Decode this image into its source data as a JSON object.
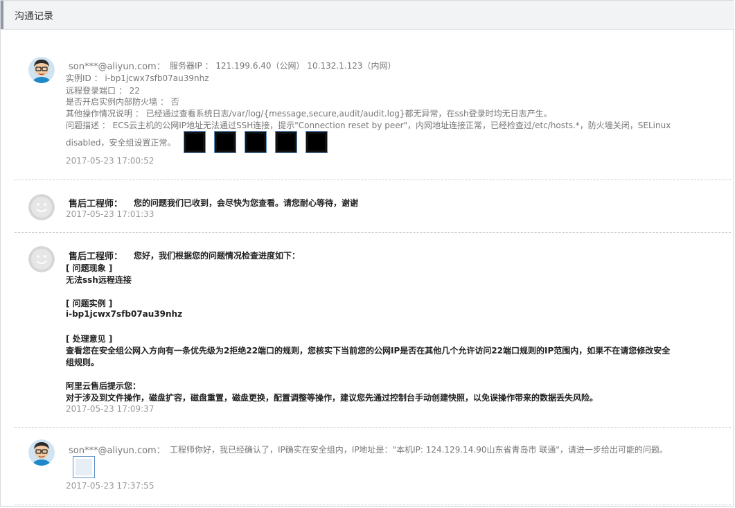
{
  "header": {
    "title": "沟通记录"
  },
  "messages": [
    {
      "sender": "son***@aliyun.com：",
      "lines": [
        "服务器IP ： 121.199.6.40（公网） 10.132.1.123（内网）",
        "实例ID ： i-bp1jcwx7sfb07au39nhz",
        "远程登录端口 ： 22",
        "是否开启实例内部防火墙 ： 否",
        "其他操作情况说明 ： 已经通过查看系统日志/var/log/{message,secure,audit/audit.log}都无异常，在ssh登录时均无日志产生。",
        "问题描述 ： ECS云主机的公网IP地址无法通过SSH连接，提示\"Connection reset by peer\"，内网地址连接正常，已经检查过/etc/hosts.*，防火墙关闭，SELinux",
        "disabled，安全组设置正常。"
      ],
      "time": "2017-05-23 17:00:52"
    },
    {
      "sender": "售后工程师：",
      "lines": [
        "您的问题我们已收到，会尽快为您查看。请您耐心等待，谢谢"
      ],
      "time": "2017-05-23 17:01:33"
    },
    {
      "sender": "售后工程师：",
      "lines": [
        "您好，我们根据您的问题情况检查进度如下：",
        "[ 问题现象 ]",
        "无法ssh远程连接",
        "[ 问题实例 ]",
        "i-bp1jcwx7sfb07au39nhz",
        "[ 处理意见 ]",
        "查看您在安全组公网入方向有一条优先级为2拒绝22端口的规则，您核实下当前您的公网IP是否在其他几个允许访问22端口规则的IP范围内，如果不在请您修改安全",
        "组规则。",
        "阿里云售后提示您：",
        "对于涉及到文件操作，磁盘扩容，磁盘重置，磁盘更换，配置调整等操作，建议您先通过控制台手动创建快照，以免误操作带来的数据丢失风险。"
      ],
      "time": "2017-05-23 17:09:37"
    },
    {
      "sender": "son***@aliyun.com：",
      "lines": [
        "工程师你好，我已经确认了，IP确实在安全组内，IP地址是：\"本机IP: 124.129.14.90山东省青岛市 联通\"，请进一步给出可能的问题。"
      ],
      "time": "2017-05-23 17:37:55"
    }
  ]
}
